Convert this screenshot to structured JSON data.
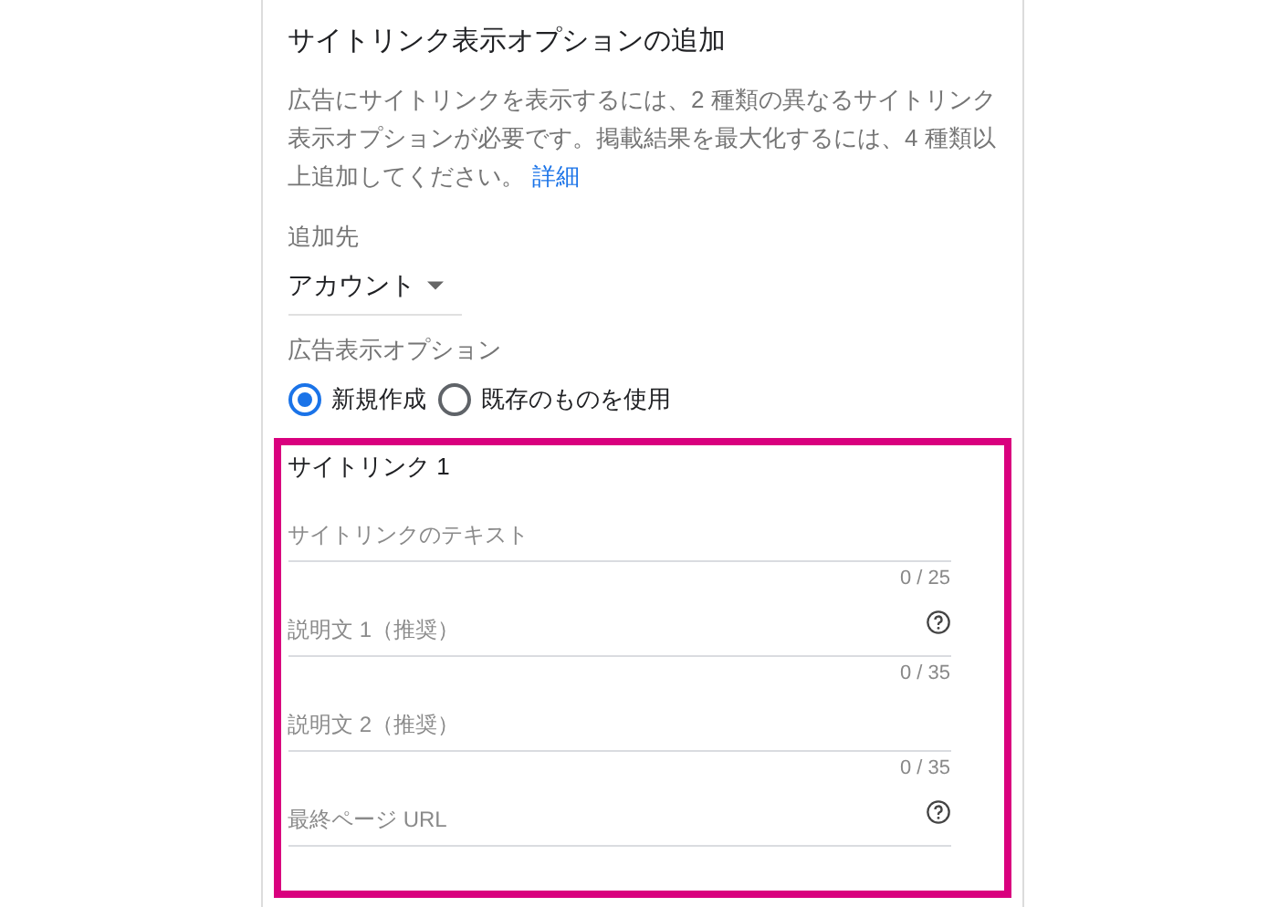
{
  "title": "サイトリンク表示オプションの追加",
  "description": {
    "text": "広告にサイトリンクを表示するには、2 種類の異なるサイトリンク表示オプションが必要です。掲載結果を最大化するには、4 種類以上追加してください。",
    "link": "詳細"
  },
  "destination": {
    "label": "追加先",
    "value": "アカウント"
  },
  "extension": {
    "label": "広告表示オプション",
    "options": [
      {
        "label": "新規作成",
        "selected": true
      },
      {
        "label": "既存のものを使用",
        "selected": false
      }
    ]
  },
  "sitelink": {
    "title": "サイトリンク 1",
    "fields": [
      {
        "placeholder": "サイトリンクのテキスト",
        "help": false,
        "counter": "0 / 25"
      },
      {
        "placeholder": "説明文 1（推奨）",
        "help": true,
        "counter": "0 / 35"
      },
      {
        "placeholder": "説明文 2（推奨）",
        "help": false,
        "counter": "0 / 35"
      },
      {
        "placeholder": "最終ページ URL",
        "help": true
      }
    ]
  }
}
